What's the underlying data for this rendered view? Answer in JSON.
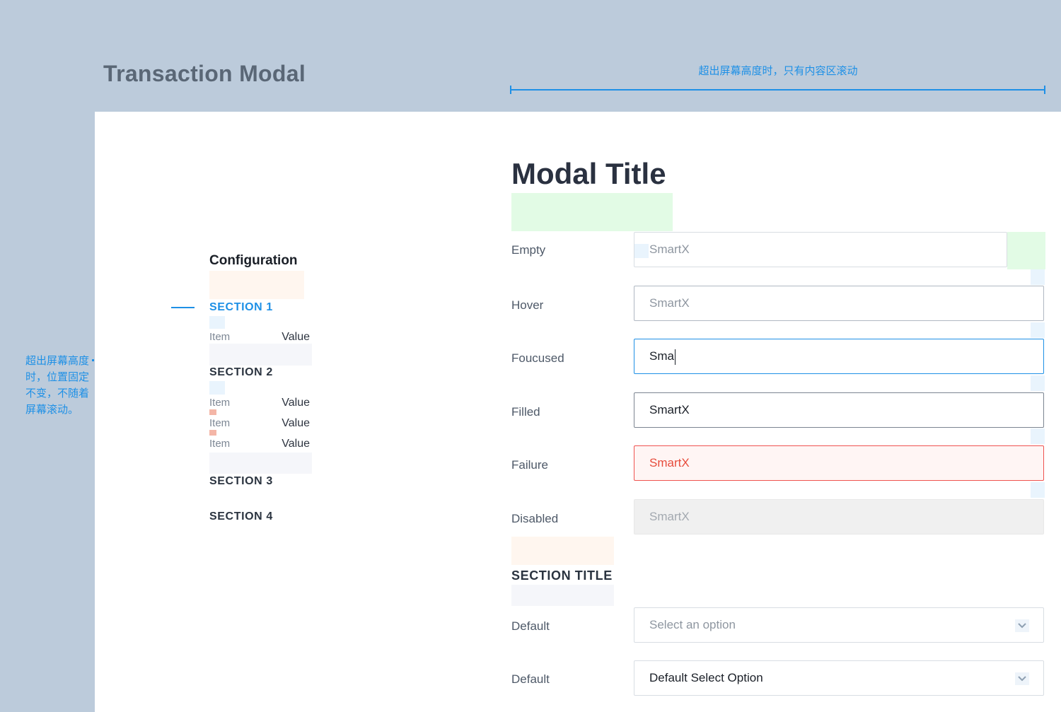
{
  "page": {
    "title": "Transaction Modal",
    "annotation_top": "超出屏幕高度时，只有内容区滚动",
    "annotation_left": "超出屏幕高度时，位置固定不变，不随着屏幕滚动。"
  },
  "nav": {
    "title": "Configuration",
    "sections": [
      {
        "label": "SECTION 1",
        "active": true,
        "items": [
          {
            "item": "Item",
            "value": "Value"
          }
        ]
      },
      {
        "label": "SECTION 2",
        "active": false,
        "items": [
          {
            "item": "Item",
            "value": "Value"
          },
          {
            "item": "Item",
            "value": "Value"
          },
          {
            "item": "Item",
            "value": "Value"
          }
        ]
      },
      {
        "label": "SECTION 3",
        "active": false,
        "items": []
      },
      {
        "label": "SECTION 4",
        "active": false,
        "items": []
      }
    ]
  },
  "modal": {
    "title": "Modal Title",
    "fields": [
      {
        "label": "Empty",
        "value": "SmartX",
        "state": "empty"
      },
      {
        "label": "Hover",
        "value": "SmartX",
        "state": "hover"
      },
      {
        "label": "Foucused",
        "value": "Sma",
        "state": "focused"
      },
      {
        "label": "Filled",
        "value": "SmartX",
        "state": "filled"
      },
      {
        "label": "Failure",
        "value": "SmartX",
        "state": "failure"
      },
      {
        "label": "Disabled",
        "value": "SmartX",
        "state": "disabled"
      }
    ],
    "section_title": "SECTION TITLE",
    "selects": [
      {
        "label": "Default",
        "value": "Select an option",
        "is_placeholder": true
      },
      {
        "label": "Default",
        "value": "Default Select Option",
        "is_placeholder": false
      }
    ]
  },
  "colors": {
    "accent": "#1e90e6",
    "error": "#ef5350",
    "background": "#bccbdb"
  },
  "icons": {
    "select_indicator": "chevron-down-icon"
  }
}
